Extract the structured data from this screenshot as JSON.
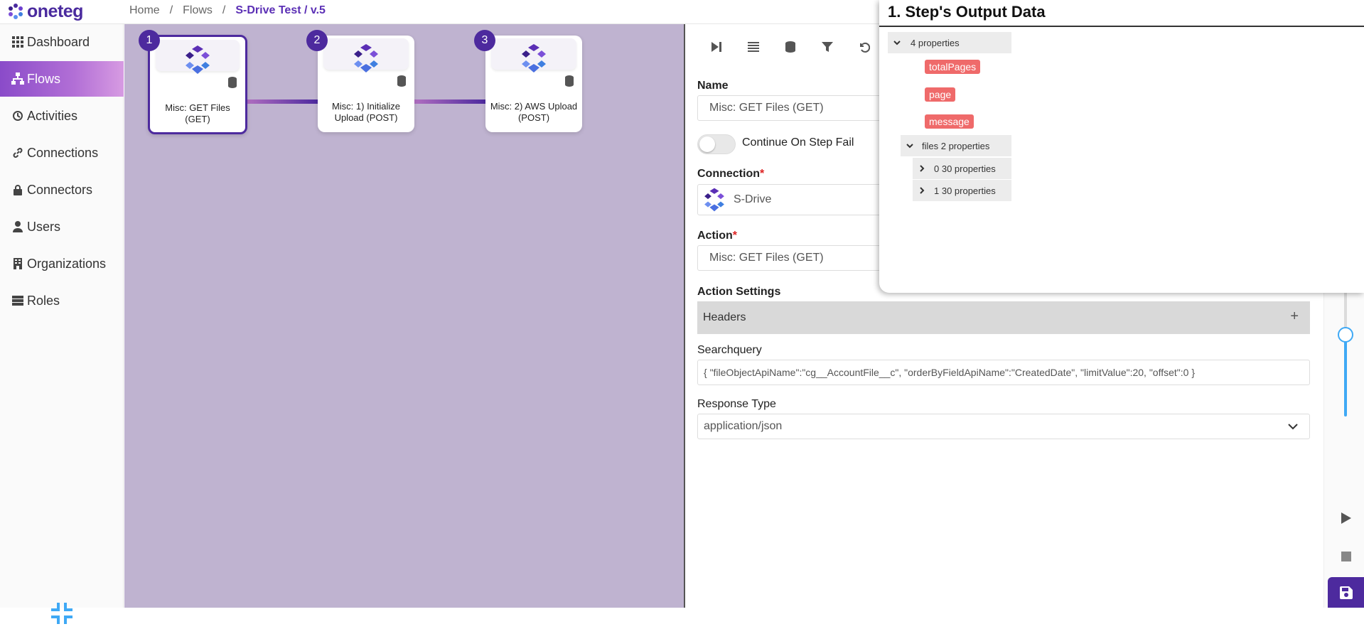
{
  "app": {
    "logo_text": "oneteg"
  },
  "breadcrumb": {
    "home": "Home",
    "flows": "Flows",
    "current": "S-Drive Test / v.5",
    "sep": "/"
  },
  "sidebar": {
    "items": [
      {
        "label": "Dashboard",
        "icon": "grid-icon"
      },
      {
        "label": "Flows",
        "icon": "sitemap-icon",
        "active": true
      },
      {
        "label": "Activities",
        "icon": "history-icon"
      },
      {
        "label": "Connections",
        "icon": "link-icon"
      },
      {
        "label": "Connectors",
        "icon": "lock-icon"
      },
      {
        "label": "Users",
        "icon": "user-icon"
      },
      {
        "label": "Organizations",
        "icon": "building-icon"
      },
      {
        "label": "Roles",
        "icon": "list-icon"
      }
    ]
  },
  "flow": {
    "nodes": [
      {
        "number": "1",
        "label": "Misc: GET Files (GET)"
      },
      {
        "number": "2",
        "label": "Misc: 1) Initialize Upload (POST)"
      },
      {
        "number": "3",
        "label": "Misc: 2) AWS Upload (POST)"
      }
    ]
  },
  "step": {
    "name_label": "Name",
    "name_value": "Misc: GET Files (GET)",
    "continue_label": "Continue On Step Fail",
    "connection_label": "Connection",
    "connection_value": "S-Drive",
    "action_label": "Action",
    "action_value": "Misc: GET Files (GET)",
    "action_settings_label": "Action Settings",
    "headers_label": "Headers",
    "headers_add": "+",
    "required_mark": "*",
    "searchquery_label": "Searchquery",
    "searchquery_value": "{ \"fileObjectApiName\":\"cg__AccountFile__c\", \"orderByFieldApiName\":\"CreatedDate\", \"limitValue\":20, \"offset\":0 }",
    "response_type_label": "Response Type",
    "response_type_value": "application/json"
  },
  "output": {
    "title": "1. Step's Output Data",
    "root": "4 properties",
    "tags": [
      "totalPages",
      "page",
      "message"
    ],
    "files": "files 2 properties",
    "items": [
      "0 30 properties",
      "1 30 properties"
    ]
  },
  "colors": {
    "brand": "#4d2a9e",
    "canvas": "#bfb3d0",
    "tag": "#ef6a6a",
    "slider": "#3fa9f5"
  }
}
